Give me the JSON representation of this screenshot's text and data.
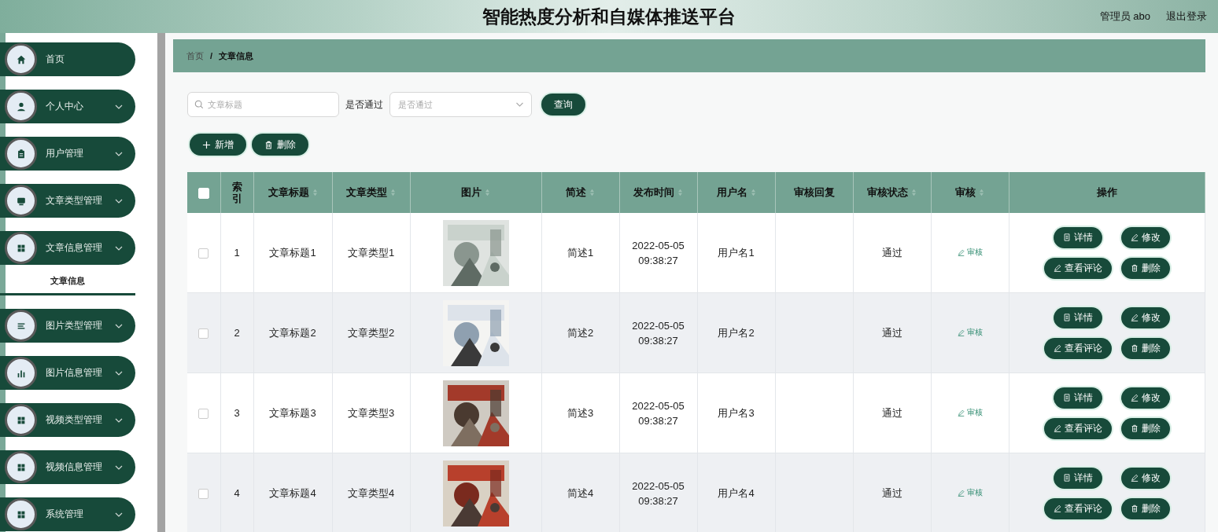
{
  "header": {
    "title": "智能热度分析和自媒体推送平台",
    "user": "管理员 abo",
    "logout": "退出登录"
  },
  "sidebar": {
    "items": [
      {
        "label": "首页",
        "selected": false,
        "submenu": false
      },
      {
        "label": "个人中心",
        "selected": false,
        "submenu": true
      },
      {
        "label": "用户管理",
        "selected": false,
        "submenu": true
      },
      {
        "label": "文章类型管理",
        "selected": false,
        "submenu": true
      },
      {
        "label": "文章信息管理",
        "selected": false,
        "submenu": true,
        "children": [
          {
            "label": "文章信息",
            "selected": true
          }
        ]
      },
      {
        "label": "图片类型管理",
        "selected": false,
        "submenu": true
      },
      {
        "label": "图片信息管理",
        "selected": false,
        "submenu": true
      },
      {
        "label": "视频类型管理",
        "selected": false,
        "submenu": true
      },
      {
        "label": "视频信息管理",
        "selected": false,
        "submenu": true
      },
      {
        "label": "系统管理",
        "selected": false,
        "submenu": true
      }
    ]
  },
  "breadcrumb": [
    "首页",
    "文章信息"
  ],
  "breadcrumb_separator": "/",
  "filters": {
    "title_field": {
      "placeholder": "文章标题"
    },
    "pass_label": "是否通过",
    "pass_select": {
      "placeholder": "是否通过"
    },
    "query_button": "查询"
  },
  "toolbar": [
    "新增",
    "删除"
  ],
  "table": {
    "all_checked": false,
    "columns": [
      {
        "label": "索引",
        "sortable": false
      },
      {
        "label": "文章标题",
        "sortable": true
      },
      {
        "label": "文章类型",
        "sortable": true
      },
      {
        "label": "图片",
        "sortable": true
      },
      {
        "label": "简述",
        "sortable": true
      },
      {
        "label": "发布时间",
        "sortable": true
      },
      {
        "label": "用户名",
        "sortable": true
      },
      {
        "label": "审核回复",
        "sortable": false
      },
      {
        "label": "审核状态",
        "sortable": true
      },
      {
        "label": "审核",
        "sortable": true
      },
      {
        "label": "操作",
        "sortable": false
      }
    ],
    "rows": [
      {
        "checked": false,
        "index": "1",
        "title": "文章标题1",
        "type": "文章类型1",
        "summary": "简述1",
        "date": "2022-05-05",
        "time": "09:38:27",
        "user": "用户名1",
        "status": "通过",
        "review": "审核",
        "actions": [
          "详情",
          "修改",
          "查看评论",
          "删除"
        ]
      },
      {
        "checked": false,
        "index": "2",
        "title": "文章标题2",
        "type": "文章类型2",
        "summary": "简述2",
        "date": "2022-05-05",
        "time": "09:38:27",
        "user": "用户名2",
        "status": "通过",
        "review": "审核",
        "actions": [
          "详情",
          "修改",
          "查看评论",
          "删除"
        ]
      },
      {
        "checked": false,
        "index": "3",
        "title": "文章标题3",
        "type": "文章类型3",
        "summary": "简述3",
        "date": "2022-05-05",
        "time": "09:38:27",
        "user": "用户名3",
        "status": "通过",
        "review": "审核",
        "actions": [
          "详情",
          "修改",
          "查看评论",
          "删除"
        ]
      },
      {
        "checked": false,
        "index": "4",
        "title": "文章标题4",
        "type": "文章类型4",
        "summary": "简述4",
        "date": "2022-05-05",
        "time": "09:38:27",
        "user": "用户名4",
        "status": "通过",
        "review": "审核",
        "actions": [
          "详情",
          "修改",
          "查看评论",
          "删除"
        ]
      }
    ]
  }
}
